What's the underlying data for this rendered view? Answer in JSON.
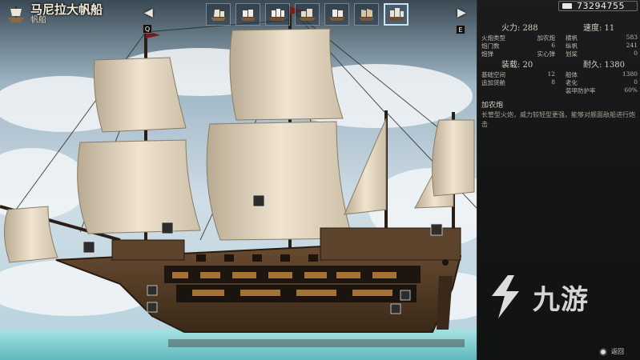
{
  "ship": {
    "name": "马尼拉大帆船",
    "subtitle": "帆船"
  },
  "nav": {
    "prev_key": "Q",
    "next_key": "E"
  },
  "ship_tabs": [
    {
      "icon": "galleon-icon"
    },
    {
      "icon": "sloop-icon"
    },
    {
      "icon": "frigate-icon"
    },
    {
      "icon": "carrack-icon"
    },
    {
      "icon": "brig-icon"
    },
    {
      "icon": "junk-icon"
    },
    {
      "icon": "manila-galleon-icon",
      "active": true
    }
  ],
  "gold": "73294755",
  "stats": {
    "firepower_label": "火力: 288",
    "speed_label": "速度: 11",
    "armor_label": "装载: 20",
    "durability_label": "耐久: 1380",
    "firepower_rows": [
      {
        "label": "火炮类型",
        "value": "加农炮"
      },
      {
        "label": "炮门数",
        "value": "6"
      },
      {
        "label": "炮弹",
        "value": "实心弹"
      }
    ],
    "speed_rows": [
      {
        "label": "横帆",
        "value": "583"
      },
      {
        "label": "纵帆",
        "value": "241"
      },
      {
        "label": "划桨",
        "value": "0"
      }
    ],
    "armor_rows": [
      {
        "label": "基础空间",
        "value": "12"
      },
      {
        "label": "追加货舱",
        "value": "8"
      }
    ],
    "durability_rows": [
      {
        "label": "船体",
        "value": "1380"
      },
      {
        "label": "老化",
        "value": "0"
      },
      {
        "label": "装甲防护率",
        "value": "60%"
      }
    ]
  },
  "description": {
    "title": "加农炮",
    "text": "长管型火炮，威力较轻型更强，能够对舰面敌船进行炮击"
  },
  "watermark": "九游",
  "back_label": "返回",
  "colors": {
    "panel_bg": "#151717",
    "sail": "#ece0cc",
    "hull": "#5a4028",
    "sea": "#8fd6d9"
  }
}
